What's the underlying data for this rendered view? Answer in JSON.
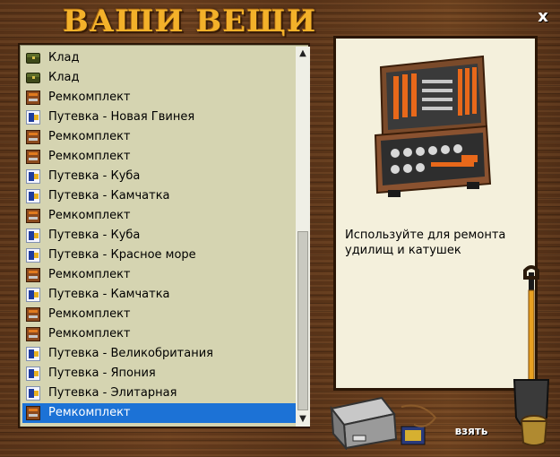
{
  "window": {
    "title": "ВАШИ ВЕЩИ",
    "close_label": "x"
  },
  "inventory": {
    "items": [
      {
        "label": "Клад",
        "icon": "treasure-chest-icon"
      },
      {
        "label": "Клад",
        "icon": "treasure-chest-icon"
      },
      {
        "label": "Ремкомплект",
        "icon": "repair-kit-icon"
      },
      {
        "label": "Путевка - Новая Гвинея",
        "icon": "travel-voucher-icon"
      },
      {
        "label": "Ремкомплект",
        "icon": "repair-kit-icon"
      },
      {
        "label": "Ремкомплект",
        "icon": "repair-kit-icon"
      },
      {
        "label": "Путевка - Куба",
        "icon": "travel-voucher-icon"
      },
      {
        "label": "Путевка - Камчатка",
        "icon": "travel-voucher-icon"
      },
      {
        "label": "Ремкомплект",
        "icon": "repair-kit-icon"
      },
      {
        "label": "Путевка - Куба",
        "icon": "travel-voucher-icon"
      },
      {
        "label": "Путевка - Красное море",
        "icon": "travel-voucher-icon"
      },
      {
        "label": "Ремкомплект",
        "icon": "repair-kit-icon"
      },
      {
        "label": "Путевка - Камчатка",
        "icon": "travel-voucher-icon"
      },
      {
        "label": "Ремкомплект",
        "icon": "repair-kit-icon"
      },
      {
        "label": "Ремкомплект",
        "icon": "repair-kit-icon"
      },
      {
        "label": "Путевка - Великобритания",
        "icon": "travel-voucher-icon"
      },
      {
        "label": "Путевка - Япония",
        "icon": "travel-voucher-icon"
      },
      {
        "label": "Путевка - Элитарная",
        "icon": "travel-voucher-icon"
      },
      {
        "label": "Ремкомплект",
        "icon": "repair-kit-icon"
      }
    ],
    "selected_index": 18
  },
  "details": {
    "image_icon": "toolbox-icon",
    "description": "Используйте для ремонта удилищ и катушек"
  },
  "actions": {
    "take_label": "взять"
  },
  "colors": {
    "selection": "#1c72d6",
    "title": "#f3b12a",
    "list_bg": "#d5d4b1",
    "panel_bg": "#f4f0dc"
  }
}
